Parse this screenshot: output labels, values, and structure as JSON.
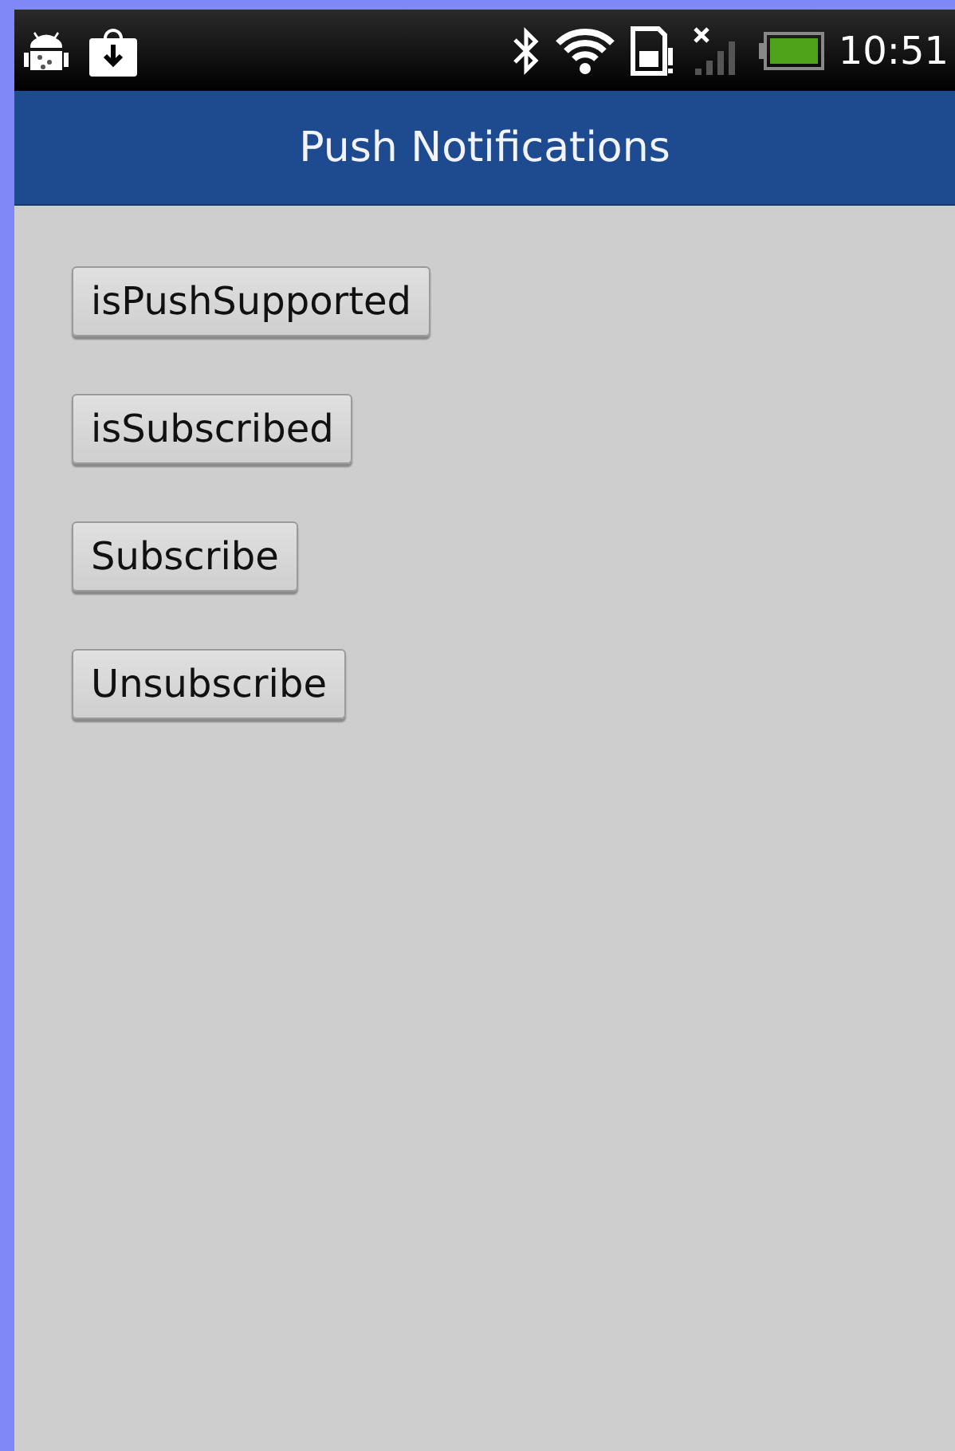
{
  "status_bar": {
    "time": "10:51"
  },
  "title_bar": {
    "title": "Push Notifications"
  },
  "buttons": [
    {
      "label": "isPushSupported"
    },
    {
      "label": "isSubscribed"
    },
    {
      "label": "Subscribe"
    },
    {
      "label": "Unsubscribe"
    }
  ]
}
